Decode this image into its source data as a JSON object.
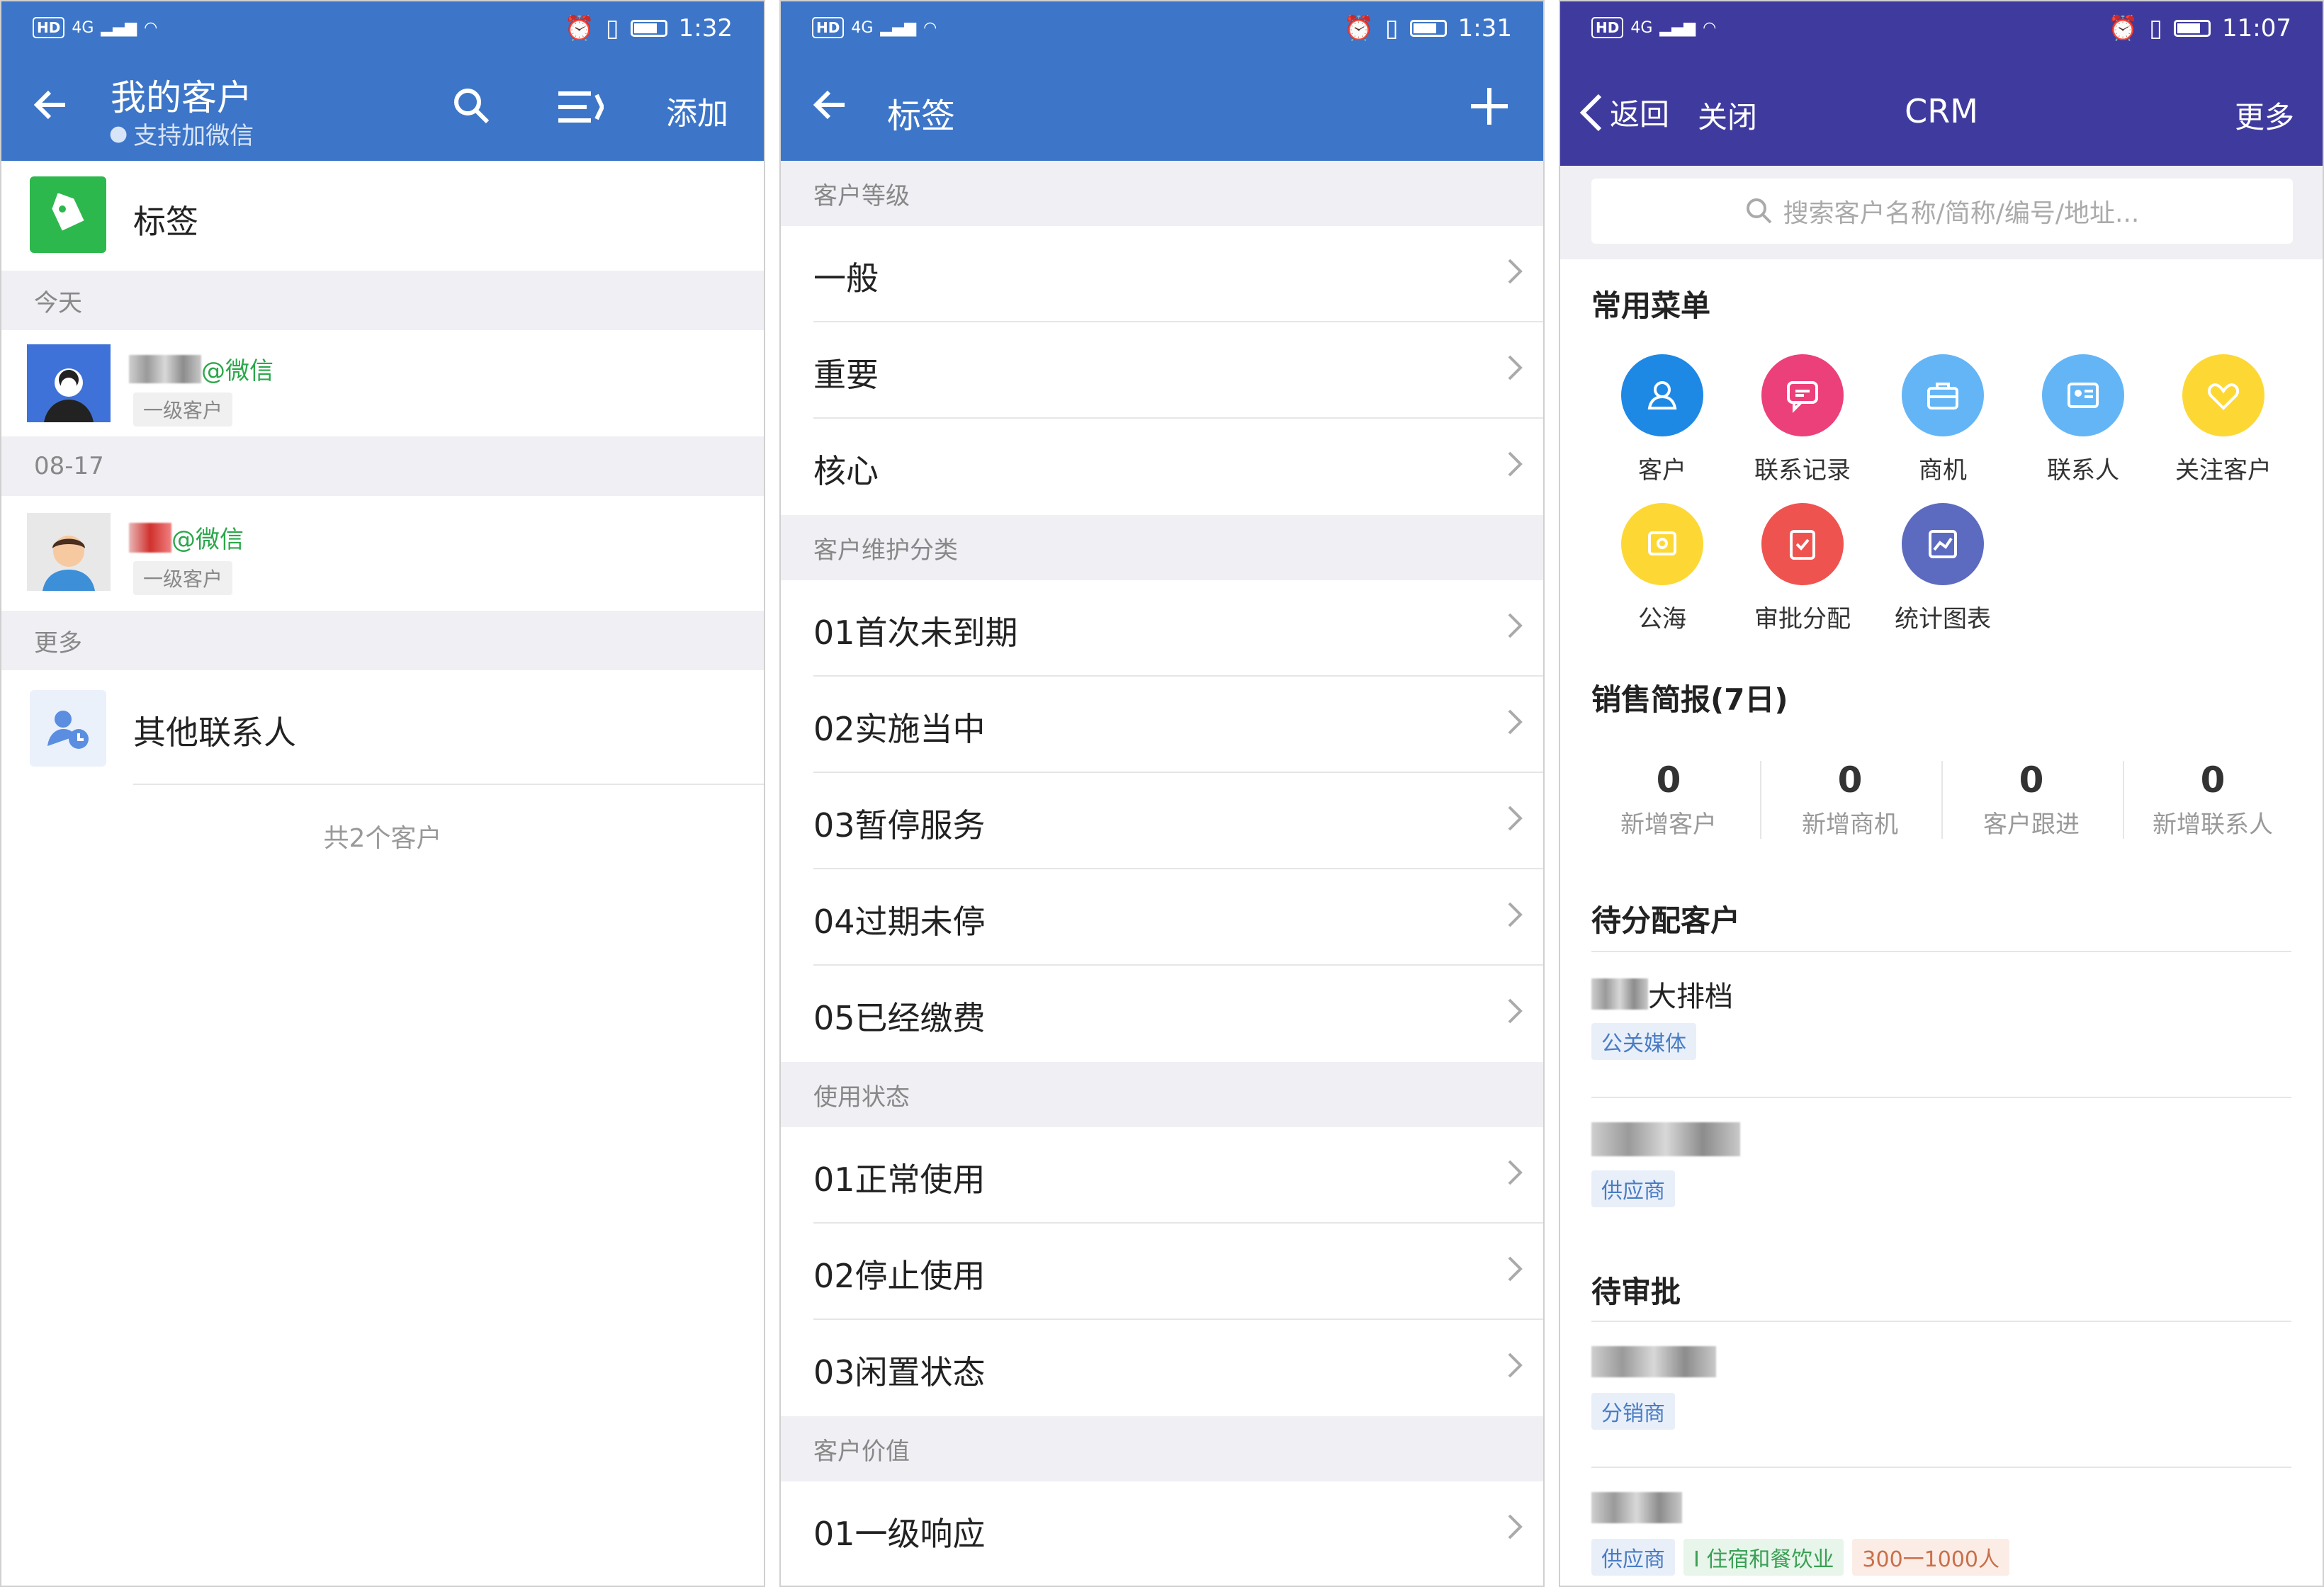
{
  "screens": [
    {
      "status": {
        "network": "4G",
        "time": "1:32"
      },
      "header": {
        "title": "我的客户",
        "subtitle": "支持加微信",
        "add_label": "添加"
      },
      "tags_row": {
        "label": "标签"
      },
      "sections": [
        {
          "label": "今天",
          "contact": {
            "suffix": "@微信",
            "level": "一级客户"
          }
        },
        {
          "label": "08-17",
          "contact": {
            "suffix": "@微信",
            "level": "一级客户"
          }
        },
        {
          "label": "更多"
        }
      ],
      "other_contacts": "其他联系人",
      "footer_count": "共2个客户",
      "colors": {
        "header": "#3d76c8",
        "tag_icon_bg": "#2db84d",
        "wechat": "#2aa84a"
      }
    },
    {
      "status": {
        "network": "4G",
        "time": "1:31"
      },
      "header": {
        "title": "标签"
      },
      "groups": [
        {
          "label": "客户等级",
          "items": [
            "一般",
            "重要",
            "核心"
          ]
        },
        {
          "label": "客户维护分类",
          "items": [
            "01首次未到期",
            "02实施当中",
            "03暂停服务",
            "04过期未停",
            "05已经缴费"
          ]
        },
        {
          "label": "使用状态",
          "items": [
            "01正常使用",
            "02停止使用",
            "03闲置状态"
          ]
        },
        {
          "label": "客户价值",
          "items": [
            "01一级响应"
          ]
        }
      ]
    },
    {
      "status": {
        "network": "4G",
        "time": "11:07"
      },
      "header": {
        "back": "返回",
        "close": "关闭",
        "title": "CRM",
        "more": "更多"
      },
      "search": {
        "placeholder": "搜索客户名称/简称/编号/地址..."
      },
      "menu": {
        "title": "常用菜单",
        "items": [
          {
            "label": "客户",
            "icon": "customer-icon",
            "color": "#1e88e5"
          },
          {
            "label": "联系记录",
            "icon": "chat-record-icon",
            "color": "#ec407a"
          },
          {
            "label": "商机",
            "icon": "briefcase-icon",
            "color": "#64b5f6"
          },
          {
            "label": "联系人",
            "icon": "contact-card-icon",
            "color": "#64b5f6"
          },
          {
            "label": "关注客户",
            "icon": "heart-icon",
            "color": "#fdd835"
          },
          {
            "label": "公海",
            "icon": "pool-icon",
            "color": "#fdd835"
          },
          {
            "label": "审批分配",
            "icon": "clipboard-check-icon",
            "color": "#ef5350"
          },
          {
            "label": "统计图表",
            "icon": "chart-icon",
            "color": "#5c6bc0"
          }
        ]
      },
      "sales": {
        "title": "销售简报(7日)",
        "stats": [
          {
            "value": "0",
            "label": "新增客户"
          },
          {
            "value": "0",
            "label": "新增商机"
          },
          {
            "value": "0",
            "label": "客户跟进"
          },
          {
            "value": "0",
            "label": "新增联系人"
          }
        ]
      },
      "pending": {
        "title": "待分配客户",
        "items": [
          {
            "name": "大排档",
            "tags": [
              "公关媒体"
            ]
          },
          {
            "name": "",
            "tags": [
              "供应商"
            ]
          }
        ]
      },
      "approval": {
        "title": "待审批",
        "items": [
          {
            "tags": [
              "分销商"
            ]
          },
          {
            "tags": [
              "供应商",
              "I 住宿和餐饮业",
              "300一1000人"
            ]
          }
        ]
      }
    }
  ]
}
